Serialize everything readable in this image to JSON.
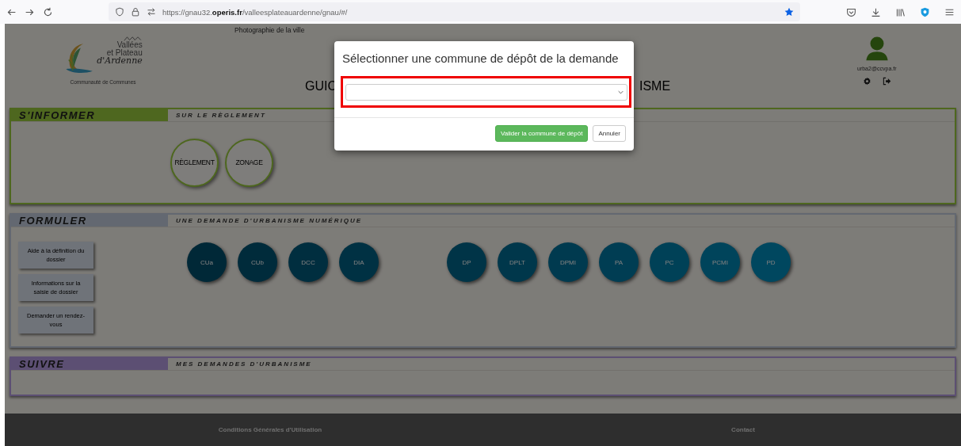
{
  "browser": {
    "url": "https://gnau32.**operis.fr**/valleesplateauardenne/gnau/#/"
  },
  "header": {
    "photo_caption": "Photographie de la ville",
    "logo": {
      "line_1": "Vallées",
      "line_2": "et Plateau",
      "line_3": "d'Ardenne",
      "subtitle": "Communauté de Communes"
    },
    "title_parts": [
      "GUIC",
      "ISME"
    ],
    "user": {
      "email": "urba2@ccvpa.fr"
    }
  },
  "sections": [
    {
      "kind": "info",
      "title": "S'INFORMER",
      "subtitle": "SUR LE RÈGLEMENT",
      "circles": [
        "RÈGLEMENT",
        "ZONAGE"
      ]
    },
    {
      "kind": "form",
      "title": "FORMULER",
      "subtitle": "UNE DEMANDE D'URBANISME NUMÉRIQUE",
      "help_buttons": [
        "Aide à la définition du dossier",
        "Informations sur la saisie de dossier",
        "Demander un rendez-vous"
      ],
      "circle_groups": [
        [
          "CUa",
          "CUb",
          "DCC",
          "DIA"
        ],
        [
          "DP",
          "DPLT",
          "DPMI",
          "PA",
          "PC",
          "PCMI",
          "PD"
        ]
      ]
    },
    {
      "kind": "track",
      "title": "SUIVRE",
      "subtitle": "MES DEMANDES D'URBANISME"
    }
  ],
  "footer": {
    "links": [
      "Conditions Générales d'Utilisation",
      "Contact"
    ]
  },
  "modal": {
    "title": "Sélectionner une commune de dépôt de la demande",
    "buttons": [
      {
        "label": "Valider la commune de dépôt",
        "kind": "primary"
      },
      {
        "label": "Annuler",
        "kind": "default"
      }
    ]
  }
}
